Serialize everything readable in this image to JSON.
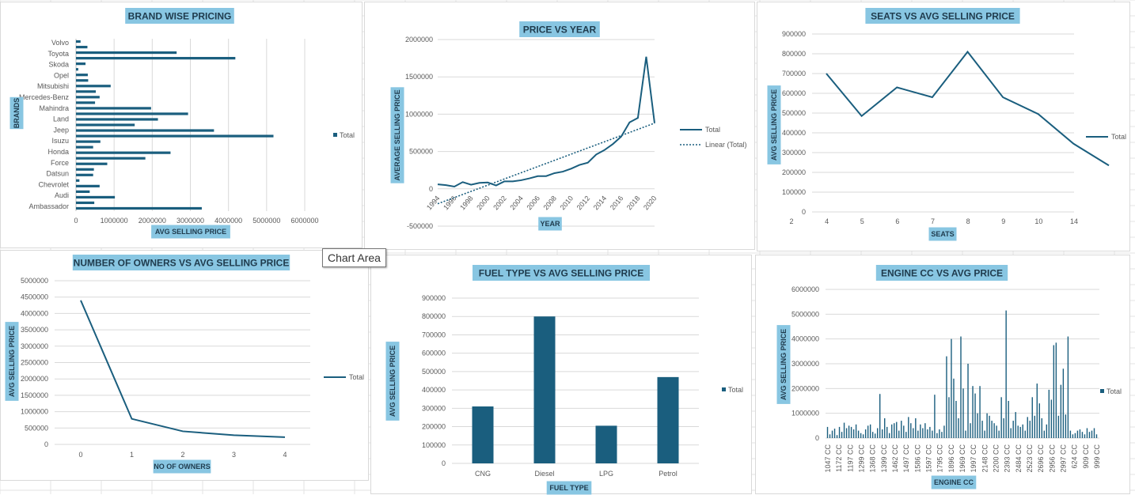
{
  "colors": {
    "series": "#1a5e7e",
    "title_bg": "#88c6e2",
    "text": "#595959",
    "title_text": "#1f3b4d",
    "grid": "#d9d9d9"
  },
  "tooltip": "Chart Area",
  "chart_data": [
    {
      "id": "brand",
      "type": "bar",
      "orientation": "horizontal",
      "title": "BRAND WISE PRICING",
      "xlabel": "AVG SELLING PRICE",
      "ylabel": "BRANDS",
      "xlim": [
        0,
        6000000
      ],
      "x_ticks": [
        "0",
        "1000000",
        "2000000",
        "3000000",
        "4000000",
        "5000000",
        "6000000"
      ],
      "category_labels": [
        "Volvo",
        "Toyota",
        "Skoda",
        "Opel",
        "Mitsubishi",
        "Mercedes-Benz",
        "Mahindra",
        "Land",
        "Jeep",
        "Isuzu",
        "Honda",
        "Force",
        "Datsun",
        "Chevrolet",
        "Audi",
        "Ambassador"
      ],
      "values": [
        3300000,
        480000,
        1020000,
        360000,
        620000,
        90000,
        450000,
        470000,
        820000,
        1820000,
        2480000,
        450000,
        640000,
        5180000,
        3620000,
        1540000,
        2150000,
        2940000,
        1970000,
        500000,
        620000,
        520000,
        910000,
        320000,
        310000,
        60000,
        250000,
        4180000,
        2640000,
        300000,
        120000
      ],
      "legend": [
        "Total"
      ],
      "legend_position": "right",
      "grid": true
    },
    {
      "id": "year",
      "type": "line",
      "title": "PRICE VS YEAR",
      "xlabel": "YEAR",
      "ylabel": "AVERAGE SELLING PRICE",
      "ylim": [
        -500000,
        2000000
      ],
      "y_ticks": [
        "-500000",
        "0",
        "500000",
        "1000000",
        "1500000",
        "2000000"
      ],
      "x_ticks": [
        "1994",
        "1996",
        "1998",
        "2000",
        "2002",
        "2004",
        "2006",
        "2008",
        "2010",
        "2012",
        "2014",
        "2016",
        "2018",
        "2020"
      ],
      "x": [
        1994,
        1995,
        1996,
        1997,
        1998,
        1999,
        2000,
        2001,
        2002,
        2003,
        2004,
        2005,
        2006,
        2007,
        2008,
        2009,
        2010,
        2011,
        2012,
        2013,
        2014,
        2015,
        2016,
        2017,
        2018,
        2019,
        2020
      ],
      "values": [
        60000,
        50000,
        30000,
        90000,
        55000,
        80000,
        85000,
        45000,
        100000,
        100000,
        115000,
        140000,
        170000,
        170000,
        210000,
        230000,
        270000,
        320000,
        350000,
        460000,
        520000,
        600000,
        700000,
        890000,
        950000,
        1770000,
        880000
      ],
      "trendline": {
        "name": "Linear (Total)",
        "from": [
          1994,
          -200000
        ],
        "to": [
          2020,
          880000
        ]
      },
      "legend": [
        "Total",
        "Linear (Total)"
      ],
      "legend_position": "right",
      "grid": true
    },
    {
      "id": "seats",
      "type": "line",
      "title": "SEATS VS AVG SELLING PRICE",
      "xlabel": "SEATS",
      "ylabel": "AVG SELLING PRICE",
      "ylim": [
        0,
        900000
      ],
      "y_ticks": [
        "0",
        "100000",
        "200000",
        "300000",
        "400000",
        "500000",
        "600000",
        "700000",
        "800000",
        "900000"
      ],
      "categories": [
        "2",
        "4",
        "5",
        "6",
        "7",
        "8",
        "9",
        "10",
        "14"
      ],
      "values": [
        700000,
        485000,
        630000,
        580000,
        810000,
        580000,
        495000,
        345000,
        235000
      ],
      "legend": [
        "Total"
      ],
      "legend_position": "right",
      "grid": true
    },
    {
      "id": "owners",
      "type": "line",
      "title": "NUMBER OF OWNERS VS AVG SELLING PRICE",
      "xlabel": "NO OF OWNERS",
      "ylabel": "AVG SELLING PRICE",
      "ylim": [
        0,
        5000000
      ],
      "y_ticks": [
        "0",
        "500000",
        "1000000",
        "1500000",
        "2000000",
        "2500000",
        "3000000",
        "3500000",
        "4000000",
        "4500000",
        "5000000"
      ],
      "categories": [
        "0",
        "1",
        "2",
        "3",
        "4"
      ],
      "values": [
        4400000,
        780000,
        400000,
        280000,
        220000
      ],
      "legend": [
        "Total"
      ],
      "legend_position": "right",
      "grid": true
    },
    {
      "id": "fuel",
      "type": "bar",
      "title": "FUEL TYPE VS AVG SELLING PRICE",
      "xlabel": "FUEL TYPE",
      "ylabel": "AVG SELLING PRICE",
      "ylim": [
        0,
        900000
      ],
      "y_ticks": [
        "0",
        "100000",
        "200000",
        "300000",
        "400000",
        "500000",
        "600000",
        "700000",
        "800000",
        "900000"
      ],
      "categories": [
        "CNG",
        "Diesel",
        "LPG",
        "Petrol"
      ],
      "values": [
        310000,
        800000,
        205000,
        470000
      ],
      "legend": [
        "Total"
      ],
      "legend_position": "right",
      "grid": true
    },
    {
      "id": "engine",
      "type": "bar",
      "title": "ENGINE CC VS AVG PRICE",
      "xlabel": "ENGINE CC",
      "ylabel": "AVG SELLING PRICE",
      "ylim": [
        0,
        6000000
      ],
      "y_ticks": [
        "0",
        "1000000",
        "2000000",
        "3000000",
        "4000000",
        "5000000",
        "6000000"
      ],
      "x_ticks": [
        "1047 CC",
        "1172 CC",
        "1197 CC",
        "1299 CC",
        "1368 CC",
        "1399 CC",
        "1462 CC",
        "1497 CC",
        "1586 CC",
        "1597 CC",
        "1795 CC",
        "1896 CC",
        "1969 CC",
        "1997 CC",
        "2148 CC",
        "2200 CC",
        "2393 CC",
        "2484 CC",
        "2523 CC",
        "2696 CC",
        "2956 CC",
        "2997 CC",
        "624 CC",
        "909 CC",
        "999 CC"
      ],
      "values": [
        450000,
        150000,
        300000,
        380000,
        120000,
        450000,
        250000,
        620000,
        400000,
        500000,
        450000,
        350000,
        550000,
        300000,
        200000,
        150000,
        350000,
        500000,
        550000,
        250000,
        180000,
        400000,
        1780000,
        350000,
        800000,
        450000,
        200000,
        550000,
        600000,
        650000,
        300000,
        700000,
        500000,
        250000,
        850000,
        600000,
        400000,
        800000,
        300000,
        550000,
        400000,
        600000,
        350000,
        450000,
        300000,
        1750000,
        200000,
        350000,
        250000,
        500000,
        3300000,
        1650000,
        4000000,
        2400000,
        1500000,
        800000,
        4100000,
        2000000,
        300000,
        3000000,
        600000,
        2100000,
        1800000,
        1000000,
        2100000,
        700000,
        300000,
        1000000,
        900000,
        700000,
        600000,
        500000,
        300000,
        1650000,
        800000,
        5150000,
        1500000,
        400000,
        700000,
        1050000,
        500000,
        450000,
        550000,
        300000,
        850000,
        700000,
        1650000,
        900000,
        2200000,
        1400000,
        800000,
        300000,
        550000,
        1950000,
        1550000,
        3750000,
        3850000,
        900000,
        2150000,
        2800000,
        950000,
        4100000,
        300000,
        150000,
        200000,
        300000,
        350000,
        250000,
        150000,
        400000,
        250000,
        300000,
        400000,
        150000
      ],
      "legend": [
        "Total"
      ],
      "legend_position": "right",
      "grid": true
    }
  ]
}
